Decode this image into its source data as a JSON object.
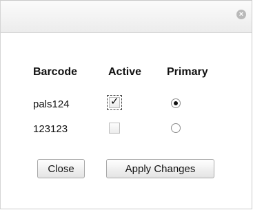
{
  "dialog": {
    "close_icon": "close-circle-icon"
  },
  "table": {
    "headers": [
      "Barcode",
      "Active",
      "Primary"
    ],
    "rows": [
      {
        "barcode": "pals124",
        "active": true,
        "primary": true
      },
      {
        "barcode": "123123",
        "active": false,
        "primary": false
      }
    ]
  },
  "buttons": {
    "close_label": "Close",
    "apply_label": "Apply Changes"
  }
}
